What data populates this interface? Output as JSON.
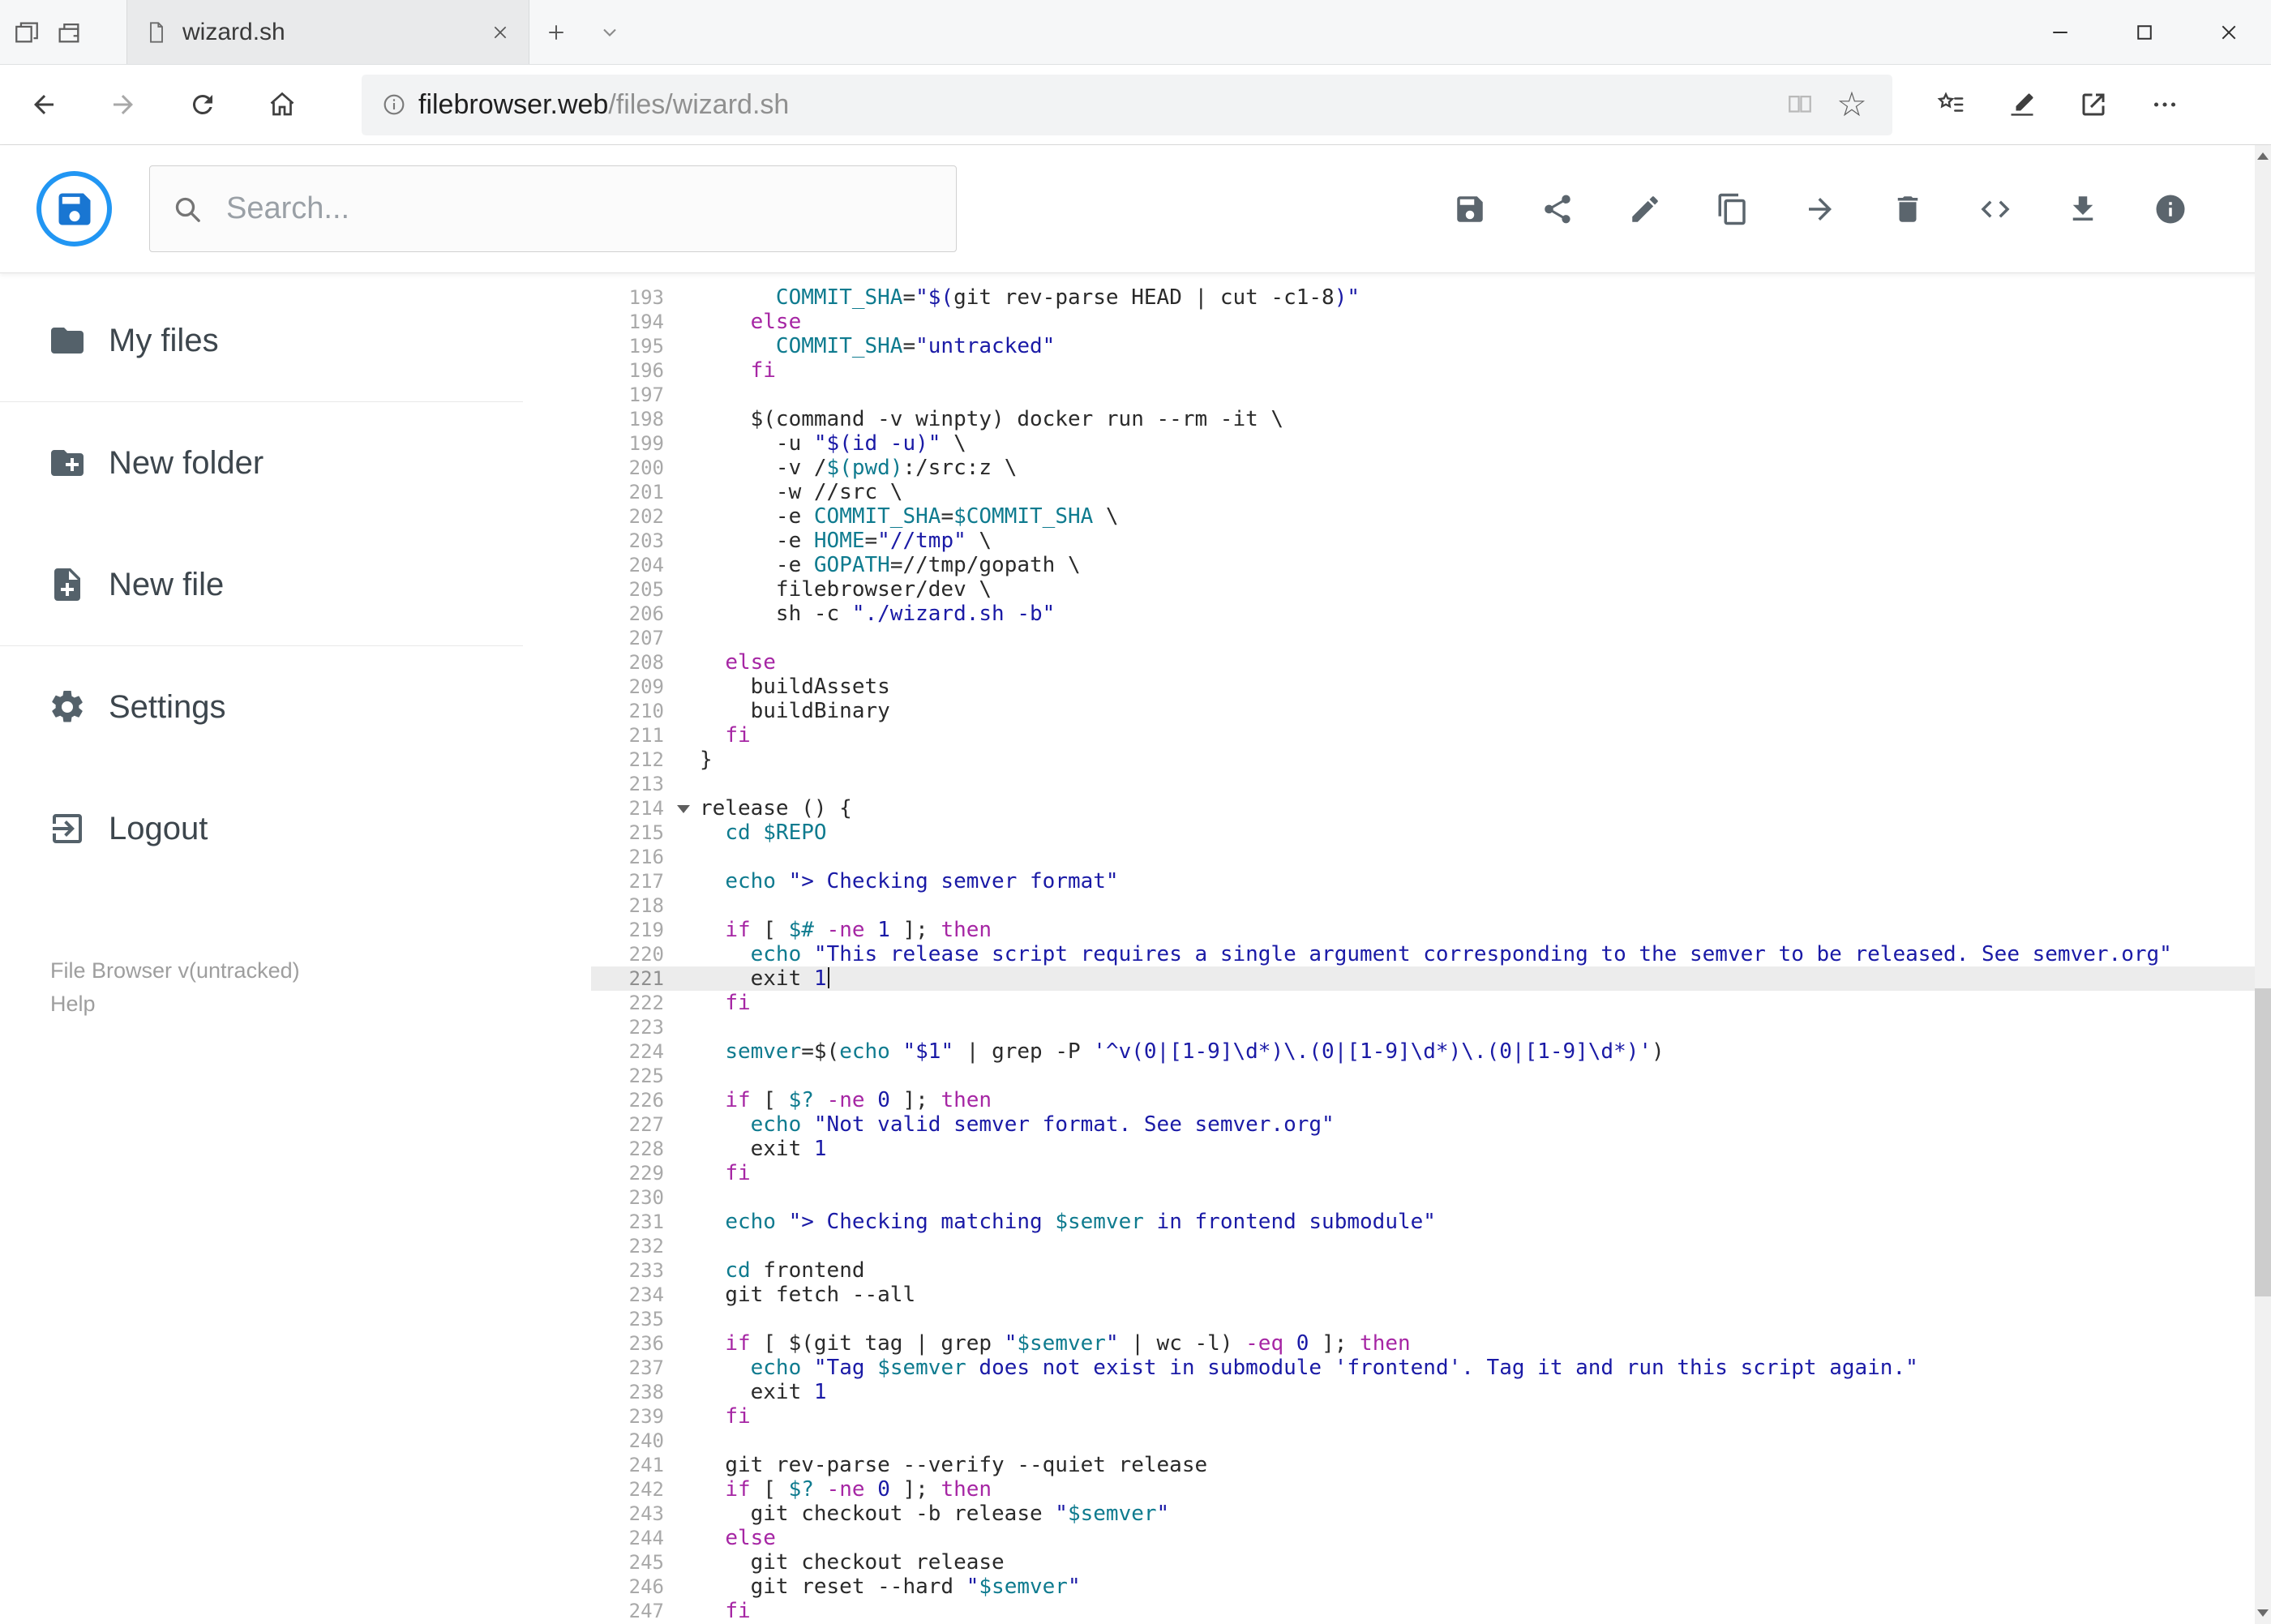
{
  "browser": {
    "tab_title": "wizard.sh",
    "address": {
      "host": "filebrowser.web",
      "path": "/files/wizard.sh"
    }
  },
  "glyphs": {
    "favorite_star": "☆"
  },
  "header": {
    "search": {
      "placeholder": "Search..."
    },
    "toolbar": [
      {
        "icon": "save-icon"
      },
      {
        "icon": "share-icon"
      },
      {
        "icon": "edit-icon"
      },
      {
        "icon": "copy-icon"
      },
      {
        "icon": "move-icon"
      },
      {
        "icon": "delete-icon"
      },
      {
        "icon": "code-icon"
      },
      {
        "icon": "download-icon"
      },
      {
        "icon": "info-icon"
      }
    ]
  },
  "sidebar": {
    "items": [
      {
        "label": "My files",
        "icon": "folder-icon"
      },
      {
        "label": "New folder",
        "icon": "create-new-folder-icon"
      },
      {
        "label": "New file",
        "icon": "new-file-icon"
      },
      {
        "label": "Settings",
        "icon": "settings-gear-icon"
      },
      {
        "label": "Logout",
        "icon": "logout-icon"
      }
    ],
    "footer": {
      "version": "File Browser v(untracked)",
      "help": "Help"
    }
  },
  "editor": {
    "active_line": 221,
    "lines": [
      {
        "n": 193,
        "tokens": [
          [
            "t",
            "      "
          ],
          [
            "v",
            "COMMIT_SHA"
          ],
          [
            "t",
            "="
          ],
          [
            "s",
            "\"$("
          ],
          [
            "t",
            "git rev-parse HEAD | cut -c1-8"
          ],
          [
            "s",
            ")\""
          ]
        ]
      },
      {
        "n": 194,
        "tokens": [
          [
            "t",
            "    "
          ],
          [
            "k",
            "else"
          ]
        ]
      },
      {
        "n": 195,
        "tokens": [
          [
            "t",
            "      "
          ],
          [
            "v",
            "COMMIT_SHA"
          ],
          [
            "t",
            "="
          ],
          [
            "s",
            "\"untracked\""
          ]
        ]
      },
      {
        "n": 196,
        "tokens": [
          [
            "t",
            "    "
          ],
          [
            "k",
            "fi"
          ]
        ]
      },
      {
        "n": 197,
        "tokens": []
      },
      {
        "n": 198,
        "tokens": [
          [
            "t",
            "    $(command -v winpty) docker run --rm -it \\"
          ]
        ]
      },
      {
        "n": 199,
        "tokens": [
          [
            "t",
            "      -u "
          ],
          [
            "s",
            "\"$(id -u)\""
          ],
          [
            "t",
            " \\"
          ]
        ]
      },
      {
        "n": 200,
        "tokens": [
          [
            "t",
            "      -v /"
          ],
          [
            "v",
            "$(pwd)"
          ],
          [
            "t",
            ":/src:z \\"
          ]
        ]
      },
      {
        "n": 201,
        "tokens": [
          [
            "t",
            "      -w //src \\"
          ]
        ]
      },
      {
        "n": 202,
        "tokens": [
          [
            "t",
            "      -e "
          ],
          [
            "v",
            "COMMIT_SHA"
          ],
          [
            "t",
            "="
          ],
          [
            "v",
            "$COMMIT_SHA"
          ],
          [
            "t",
            " \\"
          ]
        ]
      },
      {
        "n": 203,
        "tokens": [
          [
            "t",
            "      -e "
          ],
          [
            "v",
            "HOME"
          ],
          [
            "t",
            "="
          ],
          [
            "s",
            "\"//tmp\""
          ],
          [
            "t",
            " \\"
          ]
        ]
      },
      {
        "n": 204,
        "tokens": [
          [
            "t",
            "      -e "
          ],
          [
            "v",
            "GOPATH"
          ],
          [
            "t",
            "=//tmp/gopath \\"
          ]
        ]
      },
      {
        "n": 205,
        "tokens": [
          [
            "t",
            "      filebrowser/dev \\"
          ]
        ]
      },
      {
        "n": 206,
        "tokens": [
          [
            "t",
            "      sh -c "
          ],
          [
            "s",
            "\"./wizard.sh -b\""
          ]
        ]
      },
      {
        "n": 207,
        "tokens": []
      },
      {
        "n": 208,
        "tokens": [
          [
            "t",
            "  "
          ],
          [
            "k",
            "else"
          ]
        ]
      },
      {
        "n": 209,
        "tokens": [
          [
            "t",
            "    buildAssets"
          ]
        ]
      },
      {
        "n": 210,
        "tokens": [
          [
            "t",
            "    buildBinary"
          ]
        ]
      },
      {
        "n": 211,
        "tokens": [
          [
            "t",
            "  "
          ],
          [
            "k",
            "fi"
          ]
        ]
      },
      {
        "n": 212,
        "tokens": [
          [
            "t",
            "}"
          ]
        ]
      },
      {
        "n": 213,
        "tokens": []
      },
      {
        "n": 214,
        "fold": true,
        "tokens": [
          [
            "t",
            "release () {"
          ]
        ]
      },
      {
        "n": 215,
        "tokens": [
          [
            "t",
            "  "
          ],
          [
            "v",
            "cd"
          ],
          [
            "t",
            " "
          ],
          [
            "v",
            "$REPO"
          ]
        ]
      },
      {
        "n": 216,
        "tokens": []
      },
      {
        "n": 217,
        "tokens": [
          [
            "t",
            "  "
          ],
          [
            "v",
            "echo"
          ],
          [
            "t",
            " "
          ],
          [
            "s",
            "\"> Checking semver format\""
          ]
        ]
      },
      {
        "n": 218,
        "tokens": []
      },
      {
        "n": 219,
        "tokens": [
          [
            "t",
            "  "
          ],
          [
            "k",
            "if"
          ],
          [
            "t",
            " [ "
          ],
          [
            "v",
            "$#"
          ],
          [
            "t",
            " "
          ],
          [
            "o",
            "-ne"
          ],
          [
            "t",
            " "
          ],
          [
            "n",
            "1"
          ],
          [
            "t",
            " ]; "
          ],
          [
            "k",
            "then"
          ]
        ]
      },
      {
        "n": 220,
        "tokens": [
          [
            "t",
            "    "
          ],
          [
            "v",
            "echo"
          ],
          [
            "t",
            " "
          ],
          [
            "s",
            "\"This release script requires a single argument corresponding to the semver to be released. See semver.org\""
          ]
        ]
      },
      {
        "n": 221,
        "tokens": [
          [
            "t",
            "    exit "
          ],
          [
            "n",
            "1"
          ]
        ]
      },
      {
        "n": 222,
        "tokens": [
          [
            "t",
            "  "
          ],
          [
            "k",
            "fi"
          ]
        ]
      },
      {
        "n": 223,
        "tokens": []
      },
      {
        "n": 224,
        "tokens": [
          [
            "t",
            "  "
          ],
          [
            "v",
            "semver"
          ],
          [
            "t",
            "=$("
          ],
          [
            "v",
            "echo"
          ],
          [
            "t",
            " "
          ],
          [
            "s",
            "\"$1\""
          ],
          [
            "t",
            " | grep -P "
          ],
          [
            "s",
            "'^v(0|[1-9]\\d*)\\.(0|[1-9]\\d*)\\.(0|[1-9]\\d*)'"
          ],
          [
            "t",
            ")"
          ]
        ]
      },
      {
        "n": 225,
        "tokens": []
      },
      {
        "n": 226,
        "tokens": [
          [
            "t",
            "  "
          ],
          [
            "k",
            "if"
          ],
          [
            "t",
            " [ "
          ],
          [
            "v",
            "$?"
          ],
          [
            "t",
            " "
          ],
          [
            "o",
            "-ne"
          ],
          [
            "t",
            " "
          ],
          [
            "n",
            "0"
          ],
          [
            "t",
            " ]; "
          ],
          [
            "k",
            "then"
          ]
        ]
      },
      {
        "n": 227,
        "tokens": [
          [
            "t",
            "    "
          ],
          [
            "v",
            "echo"
          ],
          [
            "t",
            " "
          ],
          [
            "s",
            "\"Not valid semver format. See semver.org\""
          ]
        ]
      },
      {
        "n": 228,
        "tokens": [
          [
            "t",
            "    exit "
          ],
          [
            "n",
            "1"
          ]
        ]
      },
      {
        "n": 229,
        "tokens": [
          [
            "t",
            "  "
          ],
          [
            "k",
            "fi"
          ]
        ]
      },
      {
        "n": 230,
        "tokens": []
      },
      {
        "n": 231,
        "tokens": [
          [
            "t",
            "  "
          ],
          [
            "v",
            "echo"
          ],
          [
            "t",
            " "
          ],
          [
            "s",
            "\"> Checking matching "
          ],
          [
            "v",
            "$semver"
          ],
          [
            "s",
            " in frontend submodule\""
          ]
        ]
      },
      {
        "n": 232,
        "tokens": []
      },
      {
        "n": 233,
        "tokens": [
          [
            "t",
            "  "
          ],
          [
            "v",
            "cd"
          ],
          [
            "t",
            " frontend"
          ]
        ]
      },
      {
        "n": 234,
        "tokens": [
          [
            "t",
            "  git fetch --all"
          ]
        ]
      },
      {
        "n": 235,
        "tokens": []
      },
      {
        "n": 236,
        "tokens": [
          [
            "t",
            "  "
          ],
          [
            "k",
            "if"
          ],
          [
            "t",
            " [ $(git tag | grep "
          ],
          [
            "s",
            "\""
          ],
          [
            "v",
            "$semver"
          ],
          [
            "s",
            "\""
          ],
          [
            "t",
            " | wc -l) "
          ],
          [
            "o",
            "-eq"
          ],
          [
            "t",
            " "
          ],
          [
            "n",
            "0"
          ],
          [
            "t",
            " ]; "
          ],
          [
            "k",
            "then"
          ]
        ]
      },
      {
        "n": 237,
        "tokens": [
          [
            "t",
            "    "
          ],
          [
            "v",
            "echo"
          ],
          [
            "t",
            " "
          ],
          [
            "s",
            "\"Tag "
          ],
          [
            "v",
            "$semver"
          ],
          [
            "s",
            " does not exist in submodule 'frontend'. Tag it and run this script again.\""
          ]
        ]
      },
      {
        "n": 238,
        "tokens": [
          [
            "t",
            "    exit "
          ],
          [
            "n",
            "1"
          ]
        ]
      },
      {
        "n": 239,
        "tokens": [
          [
            "t",
            "  "
          ],
          [
            "k",
            "fi"
          ]
        ]
      },
      {
        "n": 240,
        "tokens": []
      },
      {
        "n": 241,
        "tokens": [
          [
            "t",
            "  git rev-parse --verify --quiet release"
          ]
        ]
      },
      {
        "n": 242,
        "tokens": [
          [
            "t",
            "  "
          ],
          [
            "k",
            "if"
          ],
          [
            "t",
            " [ "
          ],
          [
            "v",
            "$?"
          ],
          [
            "t",
            " "
          ],
          [
            "o",
            "-ne"
          ],
          [
            "t",
            " "
          ],
          [
            "n",
            "0"
          ],
          [
            "t",
            " ]; "
          ],
          [
            "k",
            "then"
          ]
        ]
      },
      {
        "n": 243,
        "tokens": [
          [
            "t",
            "    git checkout -b release "
          ],
          [
            "s",
            "\""
          ],
          [
            "v",
            "$semver"
          ],
          [
            "s",
            "\""
          ]
        ]
      },
      {
        "n": 244,
        "tokens": [
          [
            "t",
            "  "
          ],
          [
            "k",
            "else"
          ]
        ]
      },
      {
        "n": 245,
        "tokens": [
          [
            "t",
            "    git checkout release"
          ]
        ]
      },
      {
        "n": 246,
        "tokens": [
          [
            "t",
            "    git reset --hard "
          ],
          [
            "s",
            "\""
          ],
          [
            "v",
            "$semver"
          ],
          [
            "s",
            "\""
          ]
        ]
      },
      {
        "n": 247,
        "tokens": [
          [
            "t",
            "  "
          ],
          [
            "k",
            "fi"
          ]
        ]
      }
    ]
  }
}
